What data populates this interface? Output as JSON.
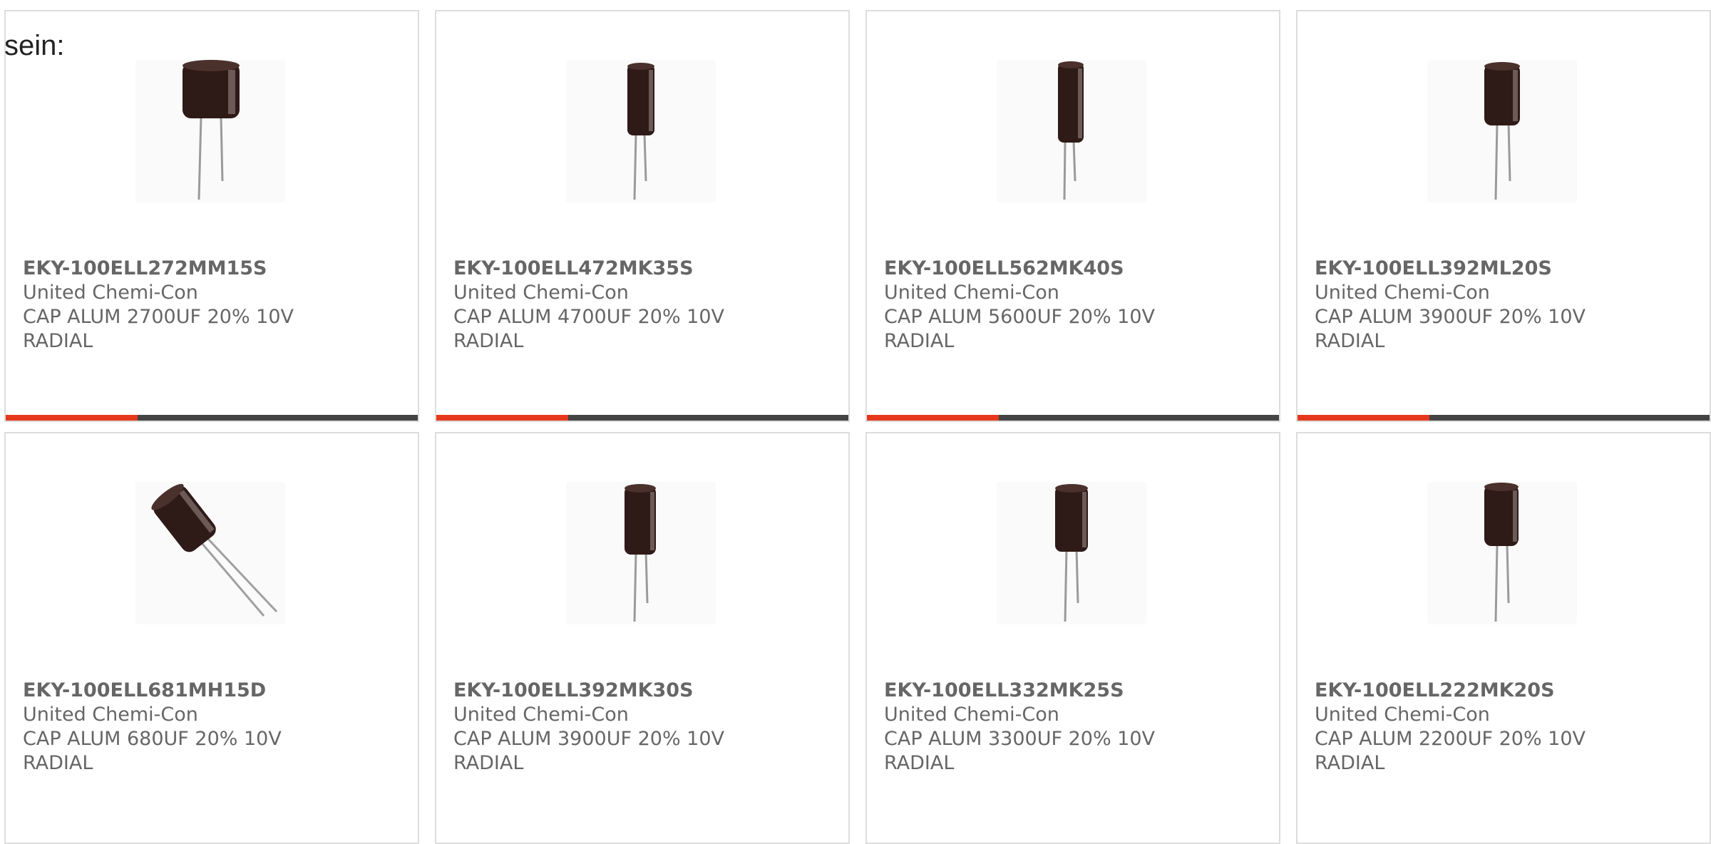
{
  "intro_text": "sein:",
  "colors": {
    "accent": "#e5381c",
    "track": "#444444",
    "text": "#666666",
    "border": "#dddddd"
  },
  "products": [
    {
      "part_number": "EKY-100ELL272MM15S",
      "manufacturer": "United Chemi-Con",
      "description_line1": "CAP ALUM 2700UF 20% 10V",
      "description_line2": "RADIAL",
      "image_icon": "capacitor-radial-icon",
      "progress": 0.32
    },
    {
      "part_number": "EKY-100ELL472MK35S",
      "manufacturer": "United Chemi-Con",
      "description_line1": "CAP ALUM 4700UF 20% 10V",
      "description_line2": "RADIAL",
      "image_icon": "capacitor-radial-icon",
      "progress": 0.32
    },
    {
      "part_number": "EKY-100ELL562MK40S",
      "manufacturer": "United Chemi-Con",
      "description_line1": "CAP ALUM 5600UF 20% 10V",
      "description_line2": "RADIAL",
      "image_icon": "capacitor-radial-icon",
      "progress": 0.32
    },
    {
      "part_number": "EKY-100ELL392ML20S",
      "manufacturer": "United Chemi-Con",
      "description_line1": "CAP ALUM 3900UF 20% 10V",
      "description_line2": "RADIAL",
      "image_icon": "capacitor-radial-icon",
      "progress": 0.32
    },
    {
      "part_number": "EKY-100ELL681MH15D",
      "manufacturer": "United Chemi-Con",
      "description_line1": "CAP ALUM 680UF 20% 10V",
      "description_line2": "RADIAL",
      "image_icon": "capacitor-radial-icon",
      "progress": null
    },
    {
      "part_number": "EKY-100ELL392MK30S",
      "manufacturer": "United Chemi-Con",
      "description_line1": "CAP ALUM 3900UF 20% 10V",
      "description_line2": "RADIAL",
      "image_icon": "capacitor-radial-icon",
      "progress": null
    },
    {
      "part_number": "EKY-100ELL332MK25S",
      "manufacturer": "United Chemi-Con",
      "description_line1": "CAP ALUM 3300UF 20% 10V",
      "description_line2": "RADIAL",
      "image_icon": "capacitor-radial-icon",
      "progress": null
    },
    {
      "part_number": "EKY-100ELL222MK20S",
      "manufacturer": "United Chemi-Con",
      "description_line1": "CAP ALUM 2200UF 20% 10V",
      "description_line2": "RADIAL",
      "image_icon": "capacitor-radial-icon",
      "progress": null
    }
  ]
}
